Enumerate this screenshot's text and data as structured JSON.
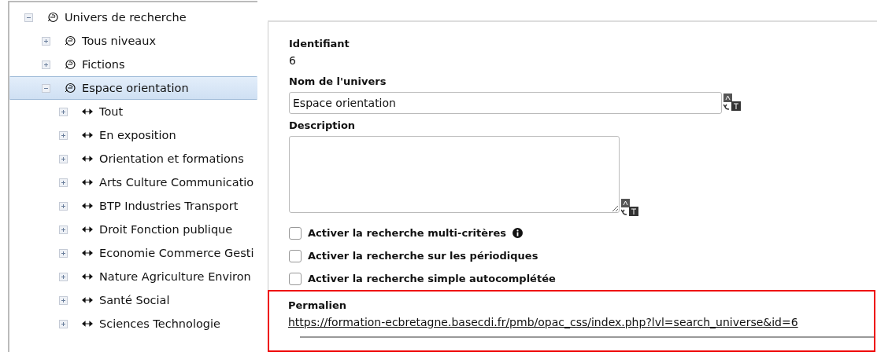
{
  "tree": {
    "label": "Univers de recherche",
    "kind": "universe",
    "expanded": true,
    "selected": false,
    "children": [
      {
        "label": "Tous niveaux",
        "kind": "universe",
        "expanded": false,
        "selected": false
      },
      {
        "label": "Fictions",
        "kind": "universe",
        "expanded": false,
        "selected": false
      },
      {
        "label": "Espace orientation",
        "kind": "universe",
        "expanded": true,
        "selected": true,
        "children": [
          {
            "label": "Tout",
            "kind": "segment",
            "expanded": false,
            "selected": false
          },
          {
            "label": "En exposition",
            "kind": "segment",
            "expanded": false,
            "selected": false
          },
          {
            "label": "Orientation et formations",
            "kind": "segment",
            "expanded": false,
            "selected": false
          },
          {
            "label": "Arts Culture Communicatio",
            "kind": "segment",
            "expanded": false,
            "selected": false
          },
          {
            "label": "BTP Industries Transport",
            "kind": "segment",
            "expanded": false,
            "selected": false
          },
          {
            "label": "Droit Fonction publique",
            "kind": "segment",
            "expanded": false,
            "selected": false
          },
          {
            "label": "Economie Commerce Gesti",
            "kind": "segment",
            "expanded": false,
            "selected": false
          },
          {
            "label": "Nature Agriculture Environ",
            "kind": "segment",
            "expanded": false,
            "selected": false
          },
          {
            "label": "Santé Social",
            "kind": "segment",
            "expanded": false,
            "selected": false
          },
          {
            "label": "Sciences Technologie",
            "kind": "segment",
            "expanded": false,
            "selected": false
          }
        ]
      }
    ]
  },
  "form": {
    "id_label": "Identifiant",
    "id_value": "6",
    "name_label": "Nom de l'univers",
    "name_value": "Espace orientation",
    "description_label": "Description",
    "options": [
      {
        "label": "Activer la recherche multi-critères",
        "checked": false,
        "info": true
      },
      {
        "label": "Activer la recherche sur les périodiques",
        "checked": false,
        "info": false
      },
      {
        "label": "Activer la recherche simple autocomplétée",
        "checked": false,
        "info": false
      }
    ],
    "permalink_label": "Permalien",
    "permalink": "https://formation-ecbretagne.basecdi.fr/pmb/opac_css/index.php?lvl=search_universe&id=6"
  }
}
